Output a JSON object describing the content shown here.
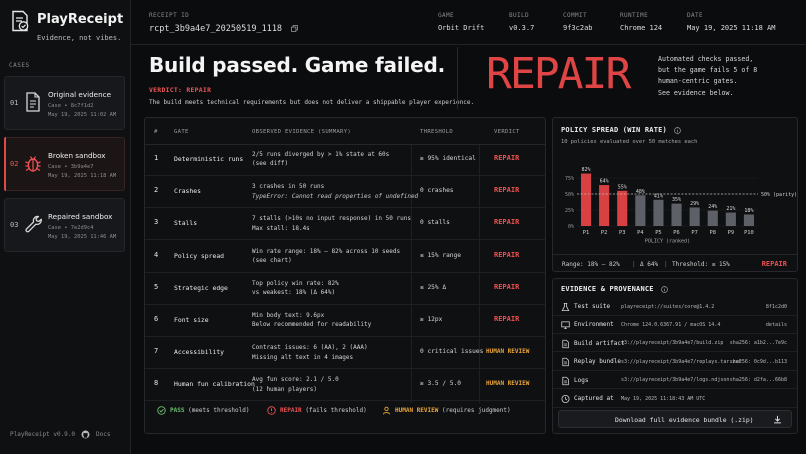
{
  "app": {
    "name": "PlayReceipt",
    "tagline": "Evidence, not vibes.",
    "version": "PlayReceipt v0.9.0",
    "docs_label": "Docs"
  },
  "sidebar": {
    "section_label": "CASES",
    "cases": [
      {
        "num": "01",
        "title": "Original evidence",
        "case": "Case • 8c7f1d2",
        "date": "May 19, 2025 11:02 AM",
        "icon": "document-icon"
      },
      {
        "num": "02",
        "title": "Broken sandbox",
        "case": "Case • 3b9a4e7",
        "date": "May 19, 2025 11:18 AM",
        "icon": "bug-icon"
      },
      {
        "num": "03",
        "title": "Repaired sandbox",
        "case": "Case • 7e2d9c4",
        "date": "May 19, 2025 11:46 AM",
        "icon": "wrench-icon"
      }
    ]
  },
  "meta": {
    "receipt_id_label": "RECEIPT ID",
    "receipt_id": "rcpt_3b9a4e7_20250519_1118",
    "game_label": "GAME",
    "game": "Orbit Drift",
    "build_label": "BUILD",
    "build": "v0.3.7",
    "commit_label": "COMMIT",
    "commit": "9f3c2ab",
    "runtime_label": "RUNTIME",
    "runtime": "Chrome 124",
    "date_label": "DATE",
    "date": "May 19, 2025 11:18 AM"
  },
  "hero": {
    "headline": "Build passed. Game failed.",
    "verdict": "VERDICT: REPAIR",
    "description": "The build meets technical requirements but does not deliver a shippable player experience.",
    "big_verdict": "REPAIR",
    "note_lines": [
      "Automated checks passed,",
      "but the game fails 5 of 8",
      "human-centric gates.",
      "See evidence below."
    ]
  },
  "gates": {
    "headers": {
      "num": "#",
      "gate": "GATE",
      "evidence": "OBSERVED EVIDENCE (SUMMARY)",
      "threshold": "THRESHOLD",
      "verdict": "VERDICT"
    },
    "rows": [
      {
        "num": "1",
        "gate": "Deterministic runs",
        "ev1": "2/5 runs diverged by > 1% state at 60s",
        "ev2": "(see diff)",
        "ev2_italic": false,
        "threshold": "≥ 95% identical",
        "verdict": "REPAIR",
        "kind": "repair"
      },
      {
        "num": "2",
        "gate": "Crashes",
        "ev1": "3 crashes in 50 runs",
        "ev2": "TypeError: Cannot read properties of undefined",
        "ev2_italic": true,
        "threshold": "0 crashes",
        "verdict": "REPAIR",
        "kind": "repair"
      },
      {
        "num": "3",
        "gate": "Stalls",
        "ev1": "7 stalls (>10s no input response) in 50 runs",
        "ev2": "Max stall: 18.4s",
        "ev2_italic": false,
        "threshold": "0 stalls",
        "verdict": "REPAIR",
        "kind": "repair"
      },
      {
        "num": "4",
        "gate": "Policy spread",
        "ev1": "Win rate range: 18% – 82% across 10 seeds",
        "ev2": "(see chart)",
        "ev2_italic": false,
        "threshold": "≤ 15% range",
        "verdict": "REPAIR",
        "kind": "repair"
      },
      {
        "num": "5",
        "gate": "Strategic edge",
        "ev1": "Top policy win rate: 82%",
        "ev2": "vs weakest: 18% (Δ 64%)",
        "ev2_italic": false,
        "threshold": "≤ 25% Δ",
        "verdict": "REPAIR",
        "kind": "repair"
      },
      {
        "num": "6",
        "gate": "Font size",
        "ev1": "Min body text: 9.6px",
        "ev2": "Below recommended for readability",
        "ev2_italic": false,
        "threshold": "≥ 12px",
        "verdict": "REPAIR",
        "kind": "repair"
      },
      {
        "num": "7",
        "gate": "Accessibility",
        "ev1": "Contrast issues: 6 (AA), 2 (AAA)",
        "ev2": "Missing alt text in 4 images",
        "ev2_italic": false,
        "threshold": "0 critical issues",
        "verdict": "HUMAN REVIEW",
        "kind": "human"
      },
      {
        "num": "8",
        "gate": "Human fun calibration",
        "ev1": "Avg fun score: 2.1 / 5.0",
        "ev2": "(12 human players)",
        "ev2_italic": false,
        "threshold": "≥ 3.5 / 5.0",
        "verdict": "HUMAN REVIEW",
        "kind": "human"
      }
    ],
    "legend": {
      "pass": "PASS",
      "pass_note": "(meets threshold)",
      "repair": "REPAIR",
      "repair_note": "(fails threshold)",
      "human": "HUMAN REVIEW",
      "human_note": "(requires judgment)"
    }
  },
  "spread": {
    "title": "POLICY SPREAD (WIN RATE)",
    "subtitle": "10 policies evaluated over 50 matches each",
    "foot_range": "Range: 18% – 82%",
    "foot_delta": "Δ 64%",
    "foot_threshold": "Threshold: ≤ 15%",
    "foot_verdict": "REPAIR"
  },
  "chart_data": {
    "type": "bar",
    "categories": [
      "P1",
      "P2",
      "P3",
      "P4",
      "P5",
      "P6",
      "P7",
      "P8",
      "P9",
      "P10"
    ],
    "values": [
      82,
      64,
      55,
      48,
      41,
      35,
      29,
      24,
      21,
      18
    ],
    "value_labels": [
      "82%",
      "64%",
      "55%",
      "48%",
      "41%",
      "35%",
      "29%",
      "24%",
      "21%",
      "18%"
    ],
    "highlight_count": 3,
    "reference_line": {
      "value": 50,
      "label": "50% (parity)"
    },
    "y_ticks": [
      "75%",
      "50%",
      "25%",
      "0%"
    ],
    "ylim": [
      0,
      100
    ],
    "xlabel": "POLICY (ranked)",
    "colors": {
      "highlight": "#d84141",
      "normal": "#5d6066"
    }
  },
  "evidence": {
    "title": "EVIDENCE & PROVENANCE",
    "rows": [
      {
        "key": "Test suite",
        "mid": "playreceipt://suites/core@1.4.2",
        "right": "8f1c2d0",
        "icon": "beaker-icon"
      },
      {
        "key": "Environment",
        "mid": "Chrome 124.0.6367.91 / macOS 14.4",
        "right": "details",
        "icon": "monitor-icon"
      },
      {
        "key": "Build artifact",
        "mid": "s3://playreceipt/3b9a4e7/build.zip",
        "right": "sha256: a1b2...7e9c",
        "icon": "file-icon"
      },
      {
        "key": "Replay bundle",
        "mid": "s3://playreceipt/3b9a4e7/replays.tar.zst",
        "right": "sha256: 0c9d...b113",
        "icon": "file-icon"
      },
      {
        "key": "Logs",
        "mid": "s3://playreceipt/3b9a4e7/logs.ndjson",
        "right": "sha256: d2fa...66b8",
        "icon": "file-icon"
      },
      {
        "key": "Captured at",
        "mid": "May 19, 2025 11:18:43 AM UTC",
        "right": "",
        "icon": "clock-icon"
      }
    ],
    "download_label": "Download full evidence bundle (.zip)"
  },
  "colors": {
    "accent_red": "#ef5252",
    "human_amber": "#e9a53a",
    "pass_green": "#6cc070"
  }
}
